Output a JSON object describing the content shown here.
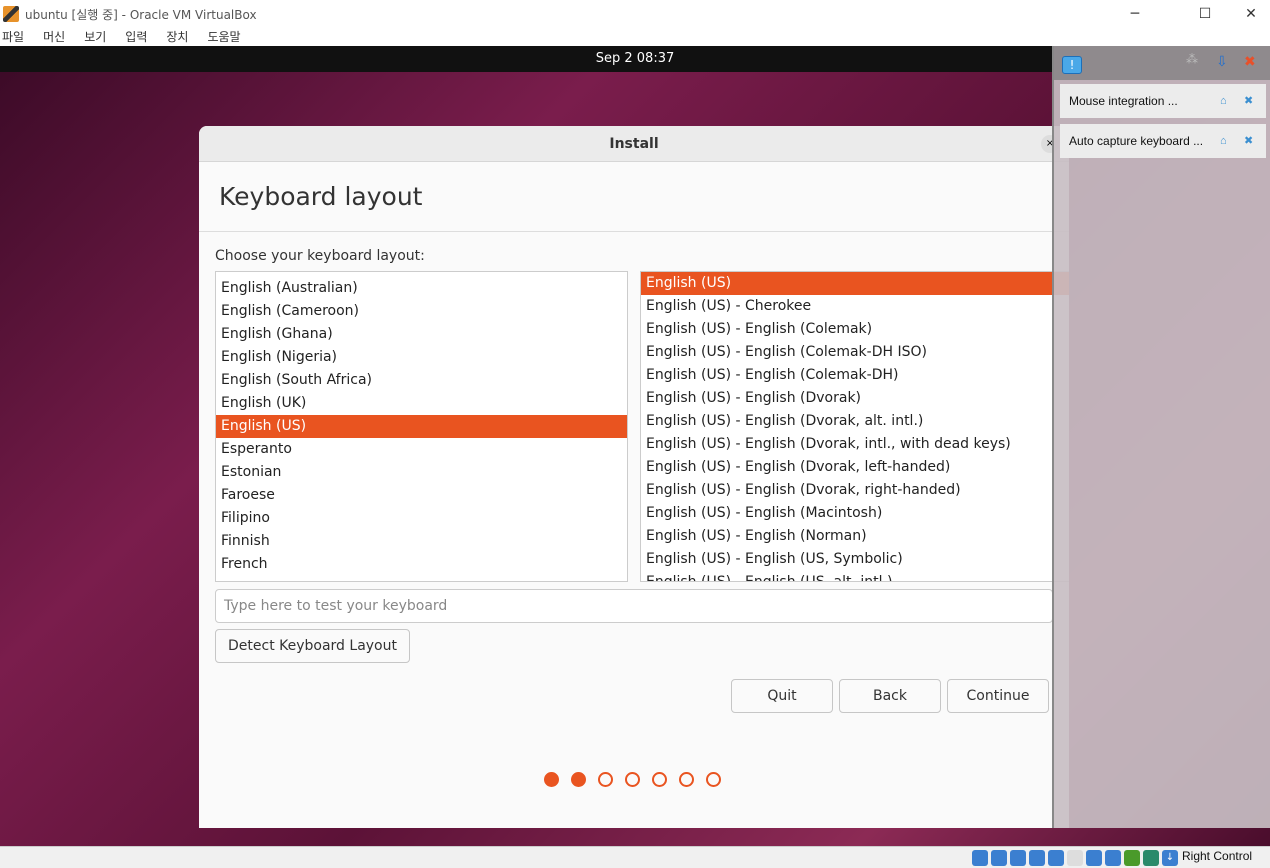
{
  "window": {
    "title": "ubuntu [실행 중] - Oracle VM VirtualBox",
    "minimize": "─",
    "maximize": "☐",
    "close": "✕"
  },
  "menu": [
    "파일",
    "머신",
    "보기",
    "입력",
    "장치",
    "도움말"
  ],
  "topbar": {
    "clock": "Sep 2  08:37"
  },
  "dialog": {
    "title": "Install",
    "close": "×",
    "heading": "Keyboard layout",
    "prompt": "Choose your keyboard layout:",
    "layouts": [
      "English (Australian)",
      "English (Cameroon)",
      "English (Ghana)",
      "English (Nigeria)",
      "English (South Africa)",
      "English (UK)",
      "English (US)",
      "Esperanto",
      "Estonian",
      "Faroese",
      "Filipino",
      "Finnish",
      "French"
    ],
    "selected_layout": "English (US)",
    "variants": [
      "English (US)",
      "English (US) - Cherokee",
      "English (US) - English (Colemak)",
      "English (US) - English (Colemak-DH ISO)",
      "English (US) - English (Colemak-DH)",
      "English (US) - English (Dvorak)",
      "English (US) - English (Dvorak, alt. intl.)",
      "English (US) - English (Dvorak, intl., with dead keys)",
      "English (US) - English (Dvorak, left-handed)",
      "English (US) - English (Dvorak, right-handed)",
      "English (US) - English (Macintosh)",
      "English (US) - English (Norman)",
      "English (US) - English (US, Symbolic)",
      "English (US) - English (US, alt. intl.)"
    ],
    "selected_variant": "English (US)",
    "test_placeholder": "Type here to test your keyboard",
    "detect_label": "Detect Keyboard Layout",
    "quit_label": "Quit",
    "back_label": "Back",
    "continue_label": "Continue",
    "steps_total": 7,
    "steps_done": 2
  },
  "notifications": [
    "Mouse integration ...",
    "Auto capture keyboard ..."
  ],
  "statusbar": {
    "host_key": "Right Control"
  },
  "colors": {
    "accent": "#e95420"
  }
}
